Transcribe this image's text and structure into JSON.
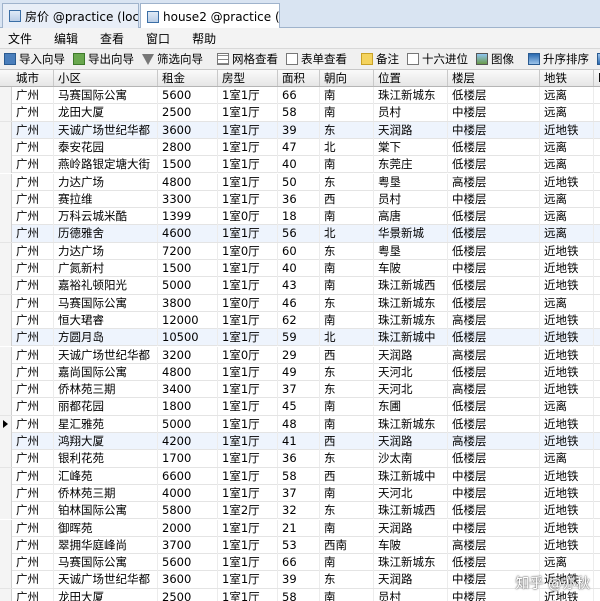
{
  "tabs": [
    {
      "label": "房价 @practice (loc...",
      "active": false
    },
    {
      "label": "house2 @practice (l...",
      "active": true
    }
  ],
  "menu": [
    "文件",
    "编辑",
    "查看",
    "窗口",
    "帮助"
  ],
  "toolbar": [
    {
      "label": "导入向导",
      "icon": "import-icon"
    },
    {
      "label": "导出向导",
      "icon": "export-icon"
    },
    {
      "label": "筛选向导",
      "icon": "filter-icon"
    },
    {
      "label": "网格查看",
      "icon": "grid-view-icon"
    },
    {
      "label": "表单查看",
      "icon": "form-view-icon"
    },
    {
      "label": "备注",
      "icon": "note-icon"
    },
    {
      "label": "十六进位",
      "icon": "hex-icon"
    },
    {
      "label": "图像",
      "icon": "image-icon"
    },
    {
      "label": "升序排序",
      "icon": "sort-asc-icon"
    },
    {
      "label": "降序排序",
      "icon": "sort-desc-icon"
    }
  ],
  "columns": [
    "城市",
    "小区",
    "租金",
    "房型",
    "面积",
    "朝向",
    "位置",
    "楼层",
    "地铁",
    "k"
  ],
  "rows": [
    [
      "广州",
      "马赛国际公寓",
      "5600",
      "1室1厅",
      "66",
      "南",
      "珠江新城东",
      "低楼层",
      "远离"
    ],
    [
      "广州",
      "龙田大厦",
      "2500",
      "1室1厅",
      "58",
      "南",
      "员村",
      "中楼层",
      "远离"
    ],
    [
      "广州",
      "天诚广场世纪华都",
      "3600",
      "1室1厅",
      "39",
      "东",
      "天润路",
      "中楼层",
      "近地铁"
    ],
    [
      "广州",
      "泰安花园",
      "2800",
      "1室1厅",
      "47",
      "北",
      "棠下",
      "低楼层",
      "远离"
    ],
    [
      "广州",
      "燕岭路银定塘大街",
      "1500",
      "1室1厅",
      "40",
      "南",
      "东莞庄",
      "低楼层",
      "远离"
    ],
    [
      "广州",
      "力达广场",
      "4800",
      "1室1厅",
      "50",
      "东",
      "粤垦",
      "高楼层",
      "近地铁"
    ],
    [
      "广州",
      "赛拉维",
      "3300",
      "1室1厅",
      "36",
      "西",
      "员村",
      "中楼层",
      "远离"
    ],
    [
      "广州",
      "万科云城米酷",
      "1399",
      "1室0厅",
      "18",
      "南",
      "高唐",
      "低楼层",
      "远离"
    ],
    [
      "广州",
      "历德雅舍",
      "4600",
      "1室1厅",
      "56",
      "北",
      "华景新城",
      "低楼层",
      "远离"
    ],
    [
      "广州",
      "力达广场",
      "7200",
      "1室0厅",
      "60",
      "东",
      "粤垦",
      "低楼层",
      "近地铁"
    ],
    [
      "广州",
      "广氮新村",
      "1500",
      "1室1厅",
      "40",
      "南",
      "车陂",
      "中楼层",
      "近地铁"
    ],
    [
      "广州",
      "嘉裕礼顿阳光",
      "5000",
      "1室1厅",
      "43",
      "南",
      "珠江新城西",
      "低楼层",
      "近地铁"
    ],
    [
      "广州",
      "马赛国际公寓",
      "3800",
      "1室0厅",
      "46",
      "东",
      "珠江新城东",
      "低楼层",
      "远离"
    ],
    [
      "广州",
      "恒大珺睿",
      "12000",
      "1室1厅",
      "62",
      "南",
      "珠江新城东",
      "高楼层",
      "近地铁"
    ],
    [
      "广州",
      "方圆月岛",
      "10500",
      "1室1厅",
      "59",
      "北",
      "珠江新城中",
      "低楼层",
      "近地铁"
    ],
    [
      "广州",
      "天诚广场世纪华都",
      "3200",
      "1室0厅",
      "29",
      "西",
      "天润路",
      "高楼层",
      "近地铁"
    ],
    [
      "广州",
      "嘉尚国际公寓",
      "4800",
      "1室1厅",
      "49",
      "东",
      "天河北",
      "低楼层",
      "近地铁"
    ],
    [
      "广州",
      "侨林苑三期",
      "3400",
      "1室1厅",
      "37",
      "东",
      "天河北",
      "高楼层",
      "近地铁"
    ],
    [
      "广州",
      "丽都花园",
      "1800",
      "1室1厅",
      "45",
      "南",
      "东圃",
      "低楼层",
      "远离"
    ],
    [
      "广州",
      "星汇雅苑",
      "5000",
      "1室1厅",
      "48",
      "南",
      "珠江新城东",
      "低楼层",
      "近地铁"
    ],
    [
      "广州",
      "鸿翔大厦",
      "4200",
      "1室1厅",
      "41",
      "西",
      "天润路",
      "高楼层",
      "近地铁"
    ],
    [
      "广州",
      "银利花苑",
      "1700",
      "1室1厅",
      "36",
      "东",
      "沙太南",
      "低楼层",
      "远离"
    ],
    [
      "广州",
      "汇峰苑",
      "6600",
      "1室1厅",
      "58",
      "西",
      "珠江新城中",
      "中楼层",
      "近地铁"
    ],
    [
      "广州",
      "侨林苑三期",
      "4000",
      "1室1厅",
      "37",
      "南",
      "天河北",
      "中楼层",
      "近地铁"
    ],
    [
      "广州",
      "铂林国际公寓",
      "5800",
      "1室2厅",
      "32",
      "东",
      "珠江新城西",
      "低楼层",
      "近地铁"
    ],
    [
      "广州",
      "御晖苑",
      "2000",
      "1室1厅",
      "21",
      "南",
      "天润路",
      "中楼层",
      "近地铁"
    ],
    [
      "广州",
      "翠拥华庭峰尚",
      "3700",
      "1室1厅",
      "53",
      "西南",
      "车陂",
      "高楼层",
      "近地铁"
    ],
    [
      "广州",
      "马赛国际公寓",
      "5600",
      "1室1厅",
      "66",
      "南",
      "珠江新城东",
      "低楼层",
      "远离"
    ],
    [
      "广州",
      "天诚广场世纪华都",
      "3600",
      "1室1厅",
      "39",
      "东",
      "天润路",
      "中楼层",
      "近地铁"
    ],
    [
      "广州",
      "龙田大厦",
      "2500",
      "1室1厅",
      "58",
      "南",
      "员村",
      "中楼层",
      "近地铁"
    ]
  ],
  "current_row_index": 19,
  "alt_rows": [
    2,
    8,
    14,
    20
  ],
  "watermark": "知乎 @亦秋"
}
